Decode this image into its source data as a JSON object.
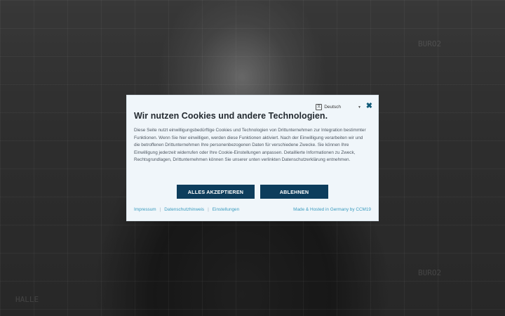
{
  "banner": {
    "title": "Wir nutzen Cookies und andere Technologien.",
    "language": "Deutsch",
    "language_icon_glyph": "文",
    "body": "Diese Seite nutzt einwilligungsbedürftige Cookies und Technologien von Drittunternehmen zur Integration bestimmter Funktionen. Wenn Sie hier einwilligen, werden diese Funktionen aktiviert. Nach der Einwilligung verarbeiten wir und die betroffenen Drittunternehmen Ihre personenbezogenen Daten für verschiedene Zwecke. Sie können Ihre Einwilligung jederzeit widerrufen oder Ihre Cookie-Einstellungen anpassen. Detaillierte Informationen zu Zweck, Rechtsgrundlagen, Drittunternehmen können Sie unserer unten verlinkten Datenschutzerklärung entnehmen.",
    "accept_label": "ALLES AKZEPTIEREN",
    "reject_label": "ABLEHNEN",
    "footer_links": [
      "Impressum",
      "Datenschutzhinweis",
      "Einstellungen"
    ],
    "footer_separator": "|",
    "credit": "Made & Hosted in Germany by CCM19"
  },
  "background": {
    "labels": [
      "BURO2",
      "BURO2",
      "HALLE"
    ]
  },
  "colors": {
    "modal_bg": "#f0f6fa",
    "button_bg": "#0d3d5c",
    "link": "#3a9bbf",
    "close": "#0f5a78"
  },
  "icons": {
    "language": "translate-icon",
    "close": "close-icon",
    "caret": "chevron-down-icon"
  }
}
